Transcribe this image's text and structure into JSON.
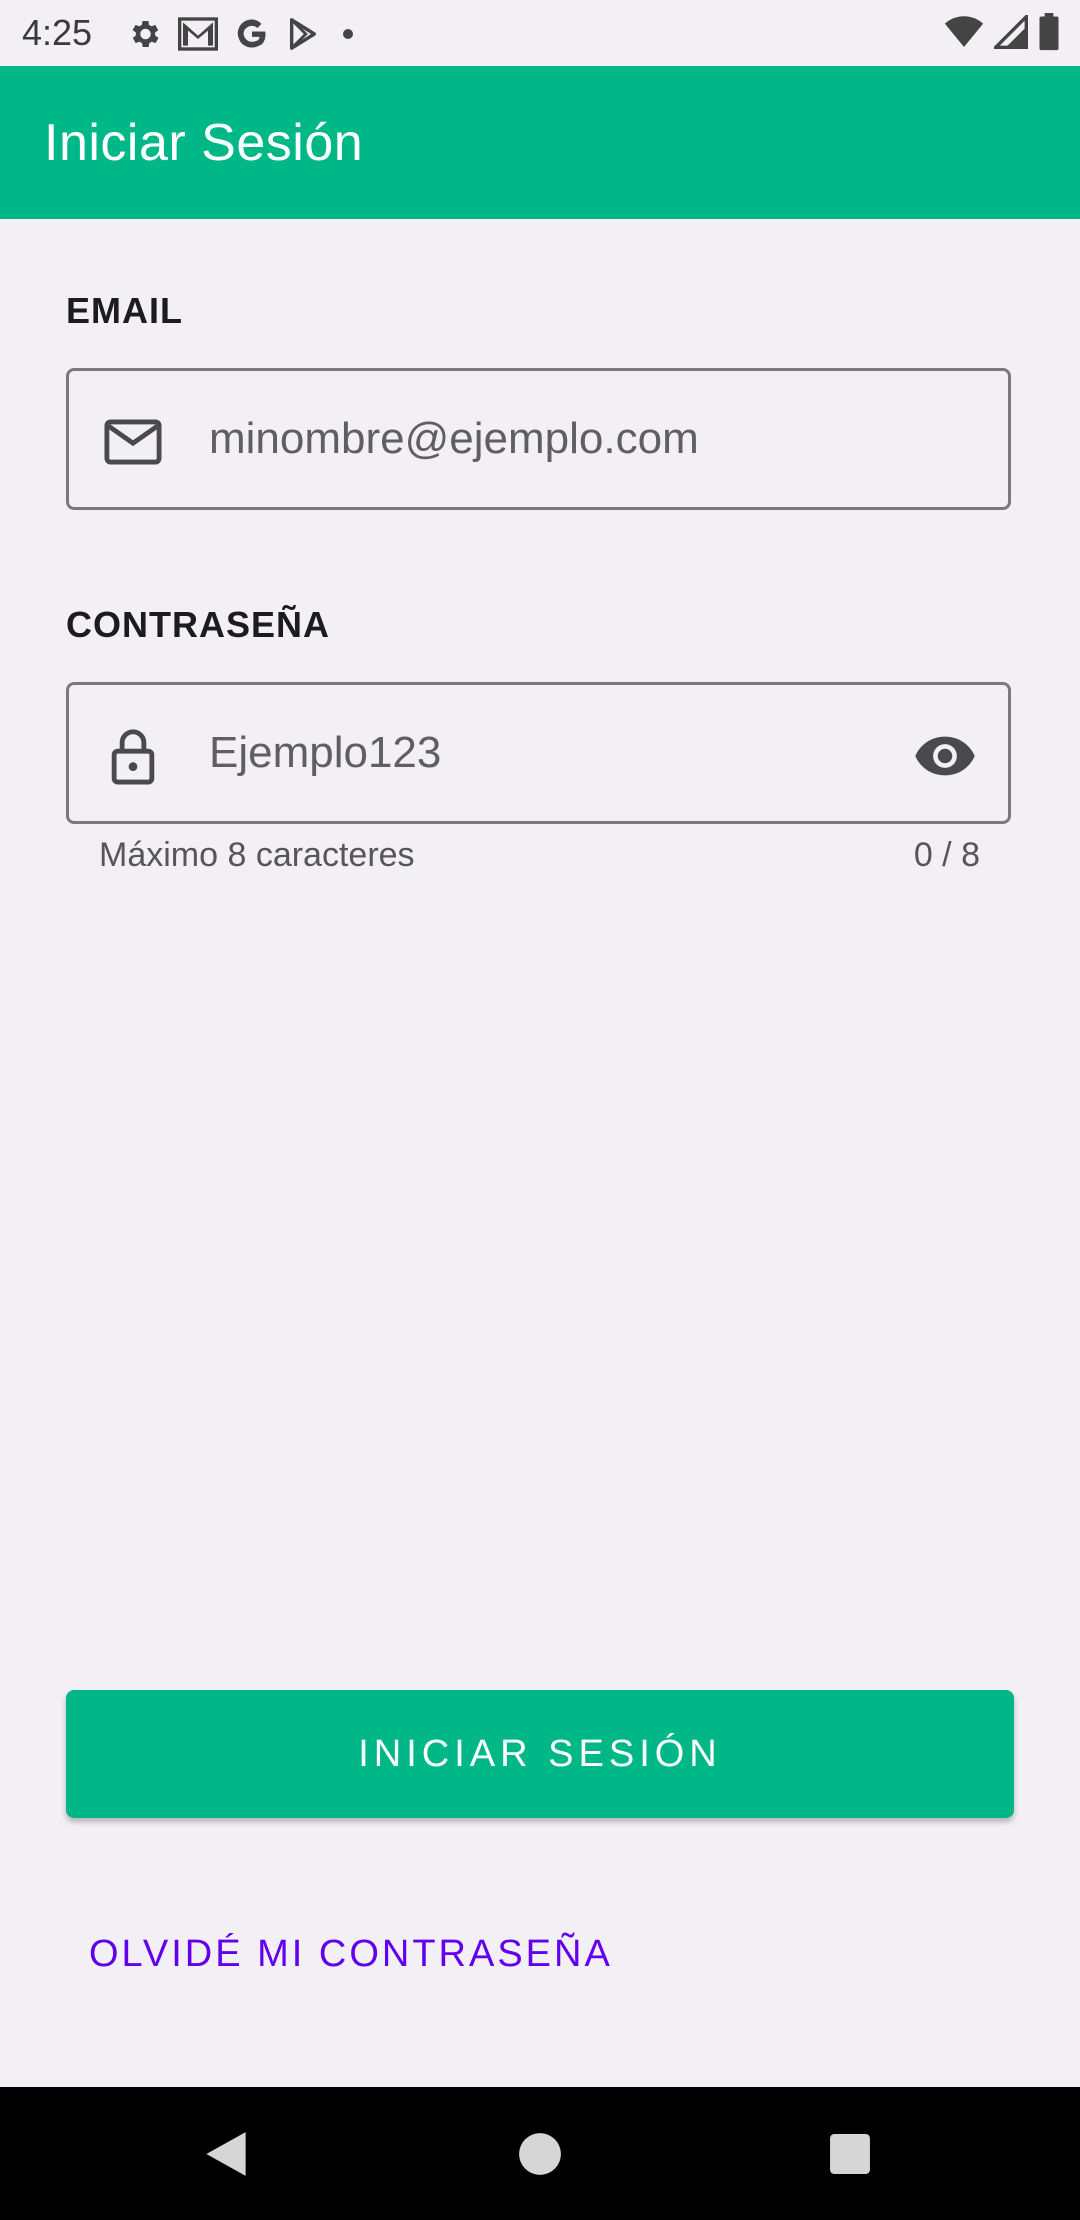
{
  "status_bar": {
    "time": "4:25",
    "left_icons": [
      "gear-icon",
      "gmail-icon",
      "google-icon",
      "play-store-icon",
      "dot-icon"
    ],
    "right_icons": [
      "wifi-icon",
      "signal-icon",
      "battery-icon"
    ]
  },
  "app_bar": {
    "title": "Iniciar Sesión",
    "color": "#00b887"
  },
  "form": {
    "email": {
      "label": "EMAIL",
      "value": "minombre@ejemplo.com",
      "icon": "mail-icon"
    },
    "password": {
      "label": "CONTRASEÑA",
      "value": "Ejemplo123",
      "icon": "lock-icon",
      "trailing_icon": "eye-icon",
      "helper": "Máximo 8 caracteres",
      "counter": "0 / 8"
    }
  },
  "actions": {
    "login_button": "INICIAR SESIÓN",
    "forgot_password": "OLVIDÉ MI CONTRASEÑA",
    "link_color": "#6200ee"
  },
  "nav_bar": {
    "buttons": [
      "back-icon",
      "home-icon",
      "recents-icon"
    ]
  }
}
